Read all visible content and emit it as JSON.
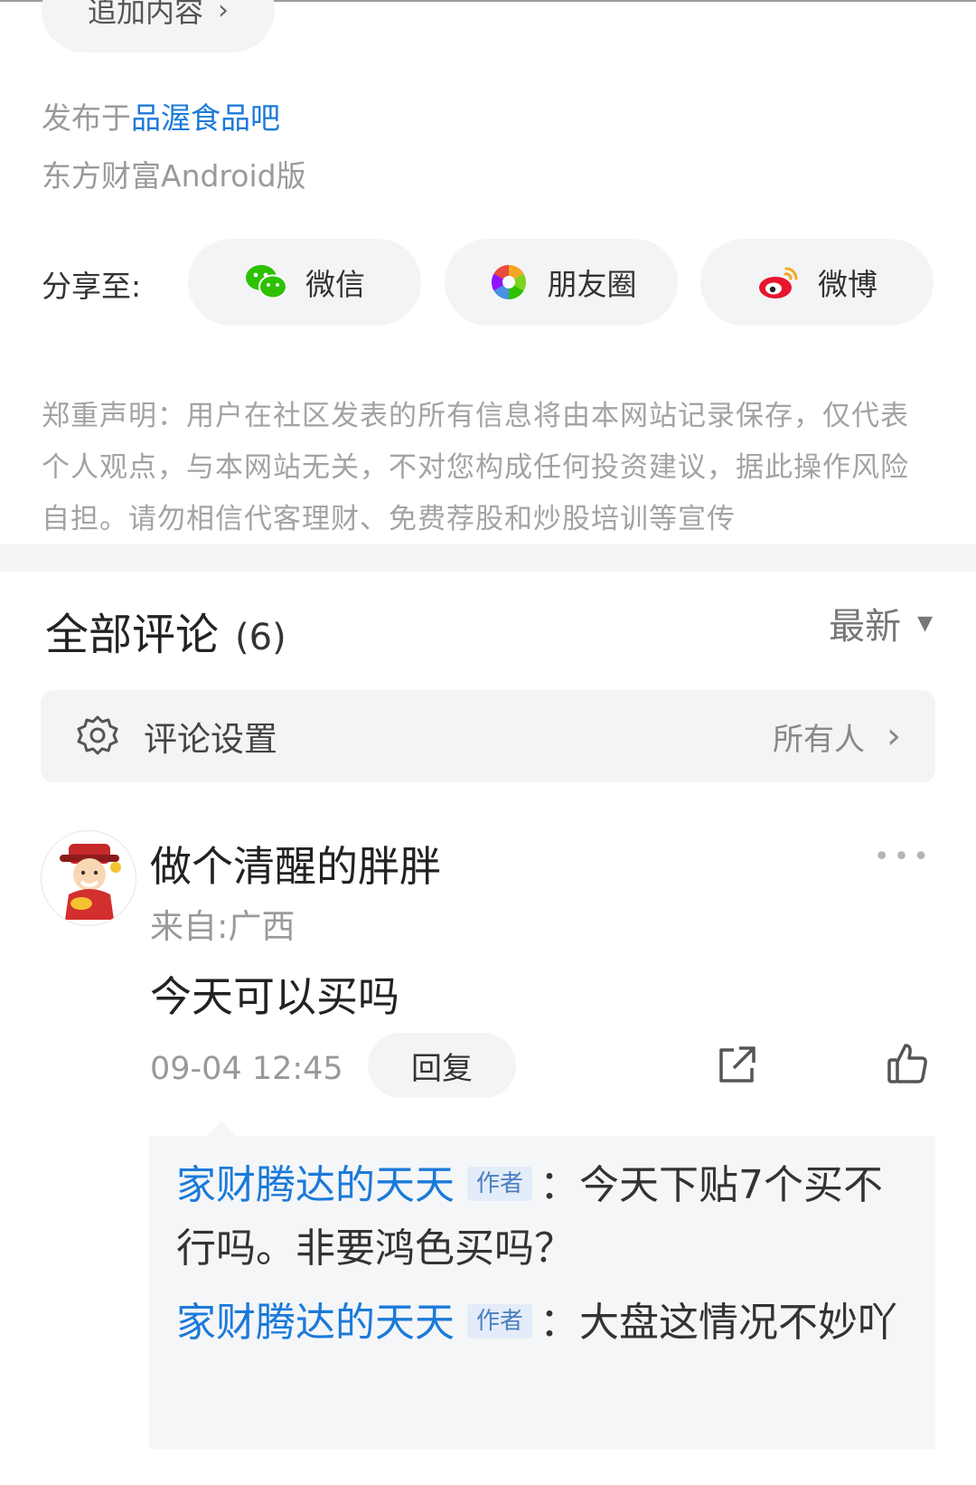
{
  "post": {
    "add_content_label": "追加内容",
    "published_prefix": "发布于",
    "bar_name": "品渥食品吧",
    "platform": "东方财富Android版"
  },
  "share": {
    "label": "分享至:",
    "wechat": "微信",
    "moments": "朋友圈",
    "weibo": "微博"
  },
  "disclaimer": "郑重声明：用户在社区发表的所有信息将由本网站记录保存，仅代表个人观点，与本网站无关，不对您构成任何投资建议，据此操作风险自担。请勿相信代客理财、免费荐股和炒股培训等宣传",
  "comments": {
    "title": "全部评论",
    "count": "(6)",
    "sort": "最新",
    "settings_label": "评论设置",
    "settings_value": "所有人"
  },
  "comment": {
    "username": "做个清醒的胖胖",
    "location": "来自:广西",
    "text": "今天可以买吗",
    "time": "09-04 12:45",
    "reply_label": "回复",
    "replies": [
      {
        "name": "家财腾达的天天",
        "badge": "作者",
        "text": "：今天下贴7个买不行吗。非要鸿色买吗？"
      },
      {
        "name": "家财腾达的天天",
        "badge": "作者",
        "text": "：大盘这情况不妙吖"
      }
    ]
  },
  "colors": {
    "link_blue": "#1b7ad9",
    "pill_bg": "#f3f4f6",
    "muted_text": "#9a9a9a"
  }
}
